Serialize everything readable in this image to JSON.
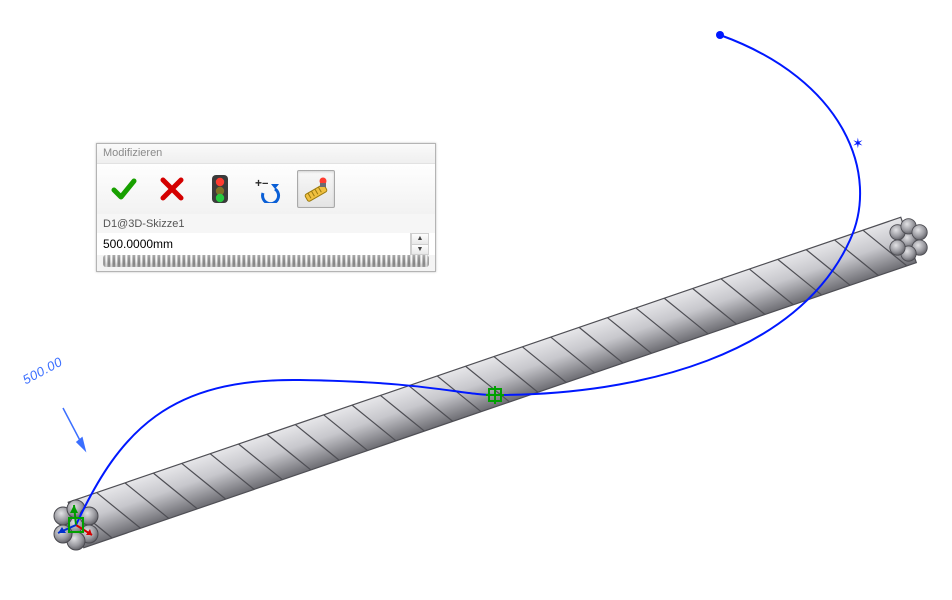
{
  "dialog": {
    "title": "Modifizieren",
    "dimension_name": "D1@3D-Skizze1",
    "dimension_value": "500.0000mm"
  },
  "annotation": {
    "dimension_text": "500.00"
  },
  "icons": {
    "accept": "accept-icon",
    "cancel": "cancel-icon",
    "traffic": "traffic-light-icon",
    "reset": "reset-icon",
    "measure": "measure-icon"
  }
}
